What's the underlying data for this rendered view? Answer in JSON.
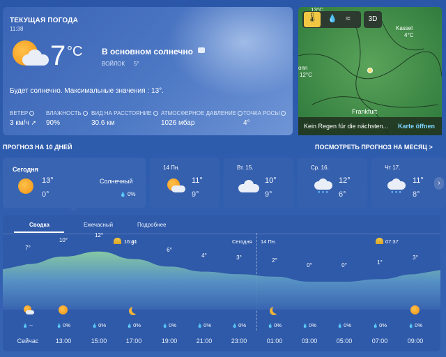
{
  "current": {
    "title": "ТЕКУЩАЯ ПОГОДА",
    "time": "11:38",
    "temp": "7",
    "unit": "°C",
    "condition": "В основном солнечно",
    "feels_label": "ВОЙЛОК",
    "feels_value": "5°",
    "summary": "Будет солнечно. Максимальные значения : 13°.",
    "metrics": [
      {
        "label": "ВЕТЕР",
        "value": "3 км/ч"
      },
      {
        "label": "ВЛАЖНОСТЬ",
        "value": "90%"
      },
      {
        "label": "ВИД НА РАССТОЯНИЕ",
        "value": "30.6 км"
      },
      {
        "label": "АТМОСФЕРНОЕ ДАВЛЕНИЕ",
        "value": "1026 мбар"
      },
      {
        "label": "ТОЧКА РОСЫ",
        "value": "4°"
      }
    ]
  },
  "map": {
    "top_label": "13°C",
    "btn_3d": "3D",
    "cities": [
      {
        "name": "Kassel",
        "temp": "4°C"
      },
      {
        "name": "onn",
        "temp": "12°C"
      },
      {
        "name": "Frankfurt",
        "temp": ""
      }
    ],
    "caption": "Kein Regen für die nächsten...",
    "link": "Karte öffnen"
  },
  "forecast10": {
    "title": "ПРОГНОЗ НА 10 ДНЕЙ",
    "month_link": "ПОСМОТРЕТЬ ПРОГНОЗ НА МЕСЯЦ >",
    "days": [
      {
        "name": "Сегодня",
        "hi": "13°",
        "lo": "0°",
        "cond": "Солнечный",
        "precip": "0%",
        "icon": "sun-icon"
      },
      {
        "name": "14 Пн.",
        "hi": "11°",
        "lo": "9°",
        "icon": "partly-sunny-icon"
      },
      {
        "name": "Вт. 15.",
        "hi": "10°",
        "lo": "9°",
        "icon": "cloud-icon"
      },
      {
        "name": "Ср. 16.",
        "hi": "12°",
        "lo": "6°",
        "icon": "rain-cloud-icon"
      },
      {
        "name": "Чт 17.",
        "hi": "11°",
        "lo": "8°",
        "icon": "rain-cloud-icon"
      }
    ]
  },
  "hourly": {
    "tabs": [
      "Сводка",
      "Ежечасный",
      "Подробнее"
    ],
    "sunset_time": "16:41",
    "today_label": "Сегодня",
    "tomorrow_label": "14 Пн.",
    "sunrise_time": "07:37",
    "temps": [
      "7°",
      "10°",
      "12°",
      "9°",
      "6°",
      "4°",
      "3°",
      "2°",
      "0°",
      "0°",
      "1°",
      "3°"
    ],
    "temp_values": [
      7,
      10,
      12,
      9,
      6,
      4,
      3,
      2,
      0,
      0,
      1,
      3
    ],
    "precip": [
      "--",
      "0%",
      "0%",
      "0%",
      "0%",
      "0%",
      "0%",
      "0%",
      "0%",
      "0%",
      "0%",
      "0%"
    ],
    "icons": [
      "partly-sunny-icon",
      "sun-icon",
      "",
      "moon-icon",
      "",
      "",
      "",
      "moon-icon",
      "",
      "",
      "",
      "sun-icon"
    ],
    "times": [
      "Сейчас",
      "13:00",
      "15:00",
      "17:00",
      "19:00",
      "21:00",
      "23:00",
      "01:00",
      "03:00",
      "05:00",
      "07:00",
      "09:00"
    ]
  },
  "colors": {
    "background": "#2b57a8",
    "sun": "#f39212",
    "accent_yellow": "#f2c744"
  }
}
